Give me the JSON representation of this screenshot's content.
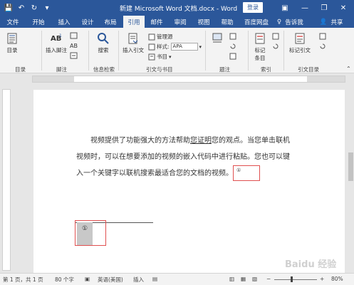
{
  "titlebar": {
    "qat": {
      "save": "💾",
      "undo": "↶",
      "redo": "↻",
      "more": "▾"
    },
    "title": "新建 Microsoft Word 文档.docx - Word",
    "login": "登录",
    "controls": {
      "ribbon_options": "▣",
      "minimize": "—",
      "restore": "❐",
      "close": "✕"
    }
  },
  "tabs": [
    "文件",
    "开始",
    "插入",
    "设计",
    "布局",
    "引用",
    "邮件",
    "审阅",
    "视图",
    "帮助",
    "百度网盘"
  ],
  "active_tab": "引用",
  "tell_me": {
    "icon": "♀",
    "label": "告诉我"
  },
  "share": {
    "icon": "👤",
    "label": "共享"
  },
  "ribbon": {
    "toc": {
      "btn": "目录",
      "group": "目录"
    },
    "footnotes": {
      "insert_footnote": "插入脚注",
      "group": "脚注"
    },
    "research": {
      "search": "搜索",
      "group": "信息检索"
    },
    "citations": {
      "insert_citation": "插入引文",
      "manage_sources": "管理源",
      "style_label": "样式:",
      "style_value": "APA",
      "bibliography": "书目",
      "group": "引文与书目"
    },
    "captions": {
      "group": "题注"
    },
    "index": {
      "mark_entry_line1": "标记",
      "mark_entry_line2": "条目",
      "group": "索引"
    },
    "toa": {
      "mark_citation": "标记引文",
      "group": "引文目录"
    }
  },
  "document": {
    "paragraph": {
      "text1": "视频提供了功能强大的方法帮助",
      "link": "您证明",
      "text2": "您的观点。当您单击联机视频时，可以在想要添加的视频的嵌入代码中进行粘贴。您也可以键入一个关键字以联机搜索最适合您的文档的视频。",
      "note_ref": "①"
    },
    "footnote_mark": "①"
  },
  "statusbar": {
    "page": "第 1 页，共 1 页",
    "words": "80 个字",
    "language": "英语(美国)",
    "insert_mode": "插入",
    "zoom": "80%"
  },
  "watermark": "Baidu 经验"
}
